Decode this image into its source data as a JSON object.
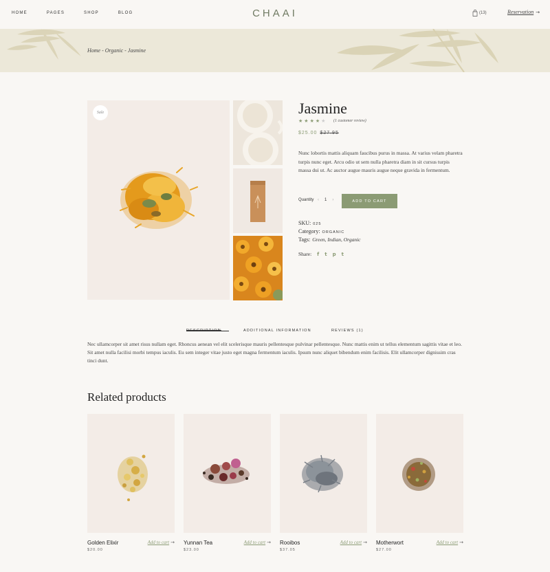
{
  "nav": {
    "items": [
      "HOME",
      "PAGES",
      "SHOP",
      "BLOG"
    ]
  },
  "logo": "CHAAI",
  "cart_count": "(13)",
  "reservation": "Reservation",
  "breadcrumb": "Home - Organic - Jasmine",
  "product": {
    "sale_badge": "Sale",
    "title": "Jasmine",
    "rating": 4,
    "review_text": "(1 customer review)",
    "price": "$25.00",
    "old_price": "$27.95",
    "description": "Nunc lobortis mattis aliquam faucibus purus in massa. At varius velam pharetra turpis nunc eget. Arcu odio ut sem nulla pharetra diam in sit cursus turpis massa dui ut. Ac auctor augue mauris augue neque gravida in fermentum.",
    "quantity_label": "Quantity",
    "quantity": "1",
    "add_to_cart": "ADD TO CART",
    "sku_label": "SKU:",
    "sku": "025",
    "category_label": "Category:",
    "category": "ORGANIC",
    "tags_label": "Tags:",
    "tags": "Green, Indian, Organic",
    "share_label": "Share:"
  },
  "tabs": {
    "items": [
      "DESCRIPTION",
      "ADDITIONAL INFORMATION",
      "REVIEWS (1)"
    ],
    "content": "Nec ullamcorper sit amet risus nullam eget. Rhoncus aenean vel elit scelerisque mauris pellentesque pulvinar pellentesque. Nunc mattis enim ut tellus elementum sagittis vitae et leo. Sit amet nulla facilisi morbi tempus iaculis. Eu sem integer vitae justo eget magna fermentum iaculis. Ipsum nunc aliquet bibendum enim facilisis. Elit ullamcorper dignissim cras tinci dunt."
  },
  "related": {
    "heading": "Related products",
    "add_label": "Add to cart",
    "items": [
      {
        "name": "Golden Elixir",
        "price": "$20.00"
      },
      {
        "name": "Yunnan Tea",
        "price": "$23.00"
      },
      {
        "name": "Rooibos",
        "price": "$37.05"
      },
      {
        "name": "Motherwort",
        "price": "$27.00"
      }
    ]
  },
  "colors": {
    "accent": "#8b9b74",
    "banner": "#ece8d9",
    "background": "#f9f7f4"
  },
  "icons": [
    "bag-icon",
    "arrow-right-icon",
    "facebook-icon",
    "twitter-icon",
    "pinterest-icon",
    "tumblr-icon",
    "star-icon"
  ]
}
